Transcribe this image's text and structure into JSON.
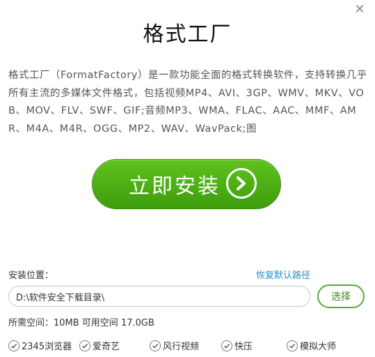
{
  "window": {
    "close_icon": "close-icon"
  },
  "title": "格式工厂",
  "description": "格式工厂（FormatFactory）是一款功能全面的格式转换软件，支持转换几乎所有主流的多媒体文件格式，包括视频MP4、AVI、3GP、WMV、MKV、VOB、MOV、FLV、SWF、GIF;音频MP3、WMA、FLAC、AAC、MMF、AMR、M4A、M4R、OGG、MP2、WAV、WavPack;图",
  "install": {
    "label": "立即安装",
    "icon": "arrow-right-circle-icon",
    "color": "#4caf17"
  },
  "install_path": {
    "label": "安装位置：",
    "restore_link": "恢复默认路径",
    "value": "D:\\软件安全下载目录\\",
    "choose_button": "选择"
  },
  "space_info": "所需空间：10MB 可用空间 17.0GB",
  "bundled_options": [
    {
      "label": "2345浏览器",
      "checked": true
    },
    {
      "label": "爱奇艺",
      "checked": true
    },
    {
      "label": "风行视频",
      "checked": true
    },
    {
      "label": "快压",
      "checked": true
    },
    {
      "label": "模拟大师",
      "checked": true
    }
  ],
  "colors": {
    "accent_green": "#4caf17",
    "link_blue": "#2a92c8"
  }
}
